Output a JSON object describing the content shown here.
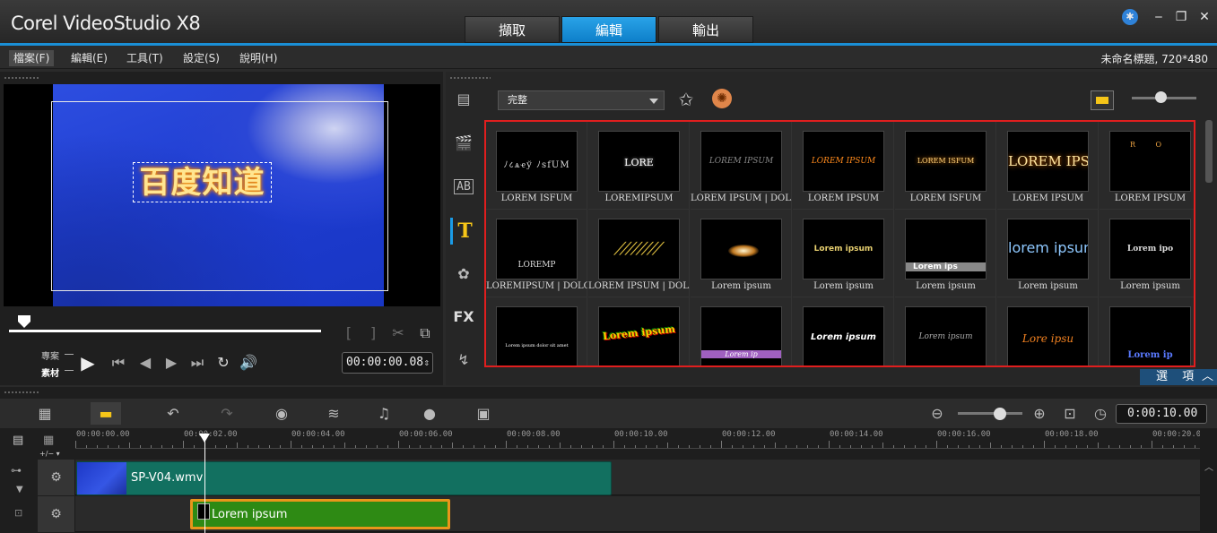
{
  "app": {
    "title": "Corel VideoStudio X8"
  },
  "tabs": [
    {
      "label": "擷取"
    },
    {
      "label": "編輯"
    },
    {
      "label": "輸出"
    }
  ],
  "menu": [
    {
      "label": "檔案(F)"
    },
    {
      "label": "編輯(E)"
    },
    {
      "label": "工具(T)"
    },
    {
      "label": "設定(S)"
    },
    {
      "label": "說明(H)"
    }
  ],
  "project_info": "未命名標題, 720*480",
  "preview": {
    "caption_text": "百度知道",
    "label_project": "專案",
    "label_clip": "素材",
    "timecode": "00:00:00.08"
  },
  "library": {
    "category": "完整",
    "options_label": "選 項",
    "titles": [
      {
        "name": "LOREM ISFUM",
        "preview": "ﾉ८ѧҽў ﾉѕfUM"
      },
      {
        "name": "LOREMIPSUM",
        "preview": "LORE"
      },
      {
        "name": "LOREM IPSUM | DOL...",
        "preview": "LOREM IPSUM"
      },
      {
        "name": "LOREM IPSUM",
        "preview": "LOREM IPSUM"
      },
      {
        "name": "LOREM ISFUM",
        "preview": "LOREM ISFUM"
      },
      {
        "name": "LOREM IPSUM",
        "preview": "LOREM IPSUM"
      },
      {
        "name": "LOREM IPSUM",
        "preview": "R O"
      },
      {
        "name": "LOREMIPSUM | DOLO...",
        "preview": "LOREMP"
      },
      {
        "name": "LOREM IPSUM | DOL...",
        "preview": "////////"
      },
      {
        "name": "Lorem ipsum",
        "preview": ""
      },
      {
        "name": "Lorem ipsum",
        "preview": "Lorem ipsum"
      },
      {
        "name": "Lorem ipsum",
        "preview": "Lorem ips"
      },
      {
        "name": "Lorem ipsum",
        "preview": "lorem ipsum"
      },
      {
        "name": "Lorem ipsum",
        "preview": "Lorem ipo"
      },
      {
        "name": "",
        "preview": "Lorem ipsum dolor sit amet"
      },
      {
        "name": "",
        "preview": "Lorem ipsum"
      },
      {
        "name": "",
        "preview": "Lorem ip"
      },
      {
        "name": "",
        "preview": "Lorem ipsum"
      },
      {
        "name": "",
        "preview": "Lorem ipsum"
      },
      {
        "name": "",
        "preview": "Lore ipsu"
      },
      {
        "name": "",
        "preview": "Lorem ip"
      }
    ]
  },
  "timeline": {
    "duration": "0:00:10.00",
    "ruler": [
      "00:00:00.00",
      "00:00:02.00",
      "00:00:04.00",
      "00:00:06.00",
      "00:00:08.00",
      "00:00:10.00",
      "00:00:12.00",
      "00:00:14.00",
      "00:00:16.00",
      "00:00:18.00",
      "00:00:20.00"
    ],
    "video_clip": "SP-V04.wmv",
    "title_clip": "Lorem ipsum",
    "add_remove": "+/− ▾"
  },
  "colors": {
    "accent": "#1a9be6",
    "video_clip": "#127060",
    "title_clip": "#2e8a14",
    "title_clip_border": "#e8961a",
    "gallery_border": "#e01e1e"
  }
}
